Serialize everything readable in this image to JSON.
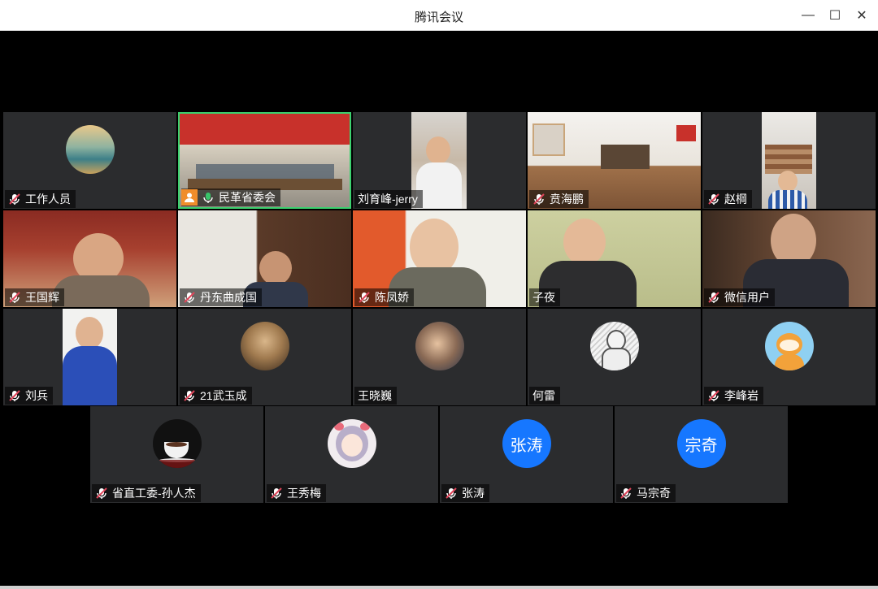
{
  "window": {
    "title": "腾讯会议"
  },
  "controls": {
    "minimize": "—",
    "maximize": "☐",
    "close": "✕"
  },
  "colors": {
    "active_border": "#3bd16f",
    "avatar_blue": "#1677ff",
    "host_badge": "#f08d2b",
    "mic_muted": "#e0455a",
    "mic_on": "#39c46a"
  },
  "participants": [
    {
      "name": "工作人员",
      "mic": "muted",
      "media": "avatar-landscape-painting"
    },
    {
      "name": "民革省委会",
      "mic": "on",
      "host": true,
      "media": "video-meeting-room-banner"
    },
    {
      "name": "刘育峰-jerry",
      "mic": "none",
      "media": "video"
    },
    {
      "name": "贲海鹏",
      "mic": "muted",
      "media": "video-office"
    },
    {
      "name": "赵棡",
      "mic": "muted",
      "media": "video"
    },
    {
      "name": "王国辉",
      "mic": "muted",
      "media": "video"
    },
    {
      "name": "丹东曲成国",
      "mic": "muted",
      "media": "video"
    },
    {
      "name": "陈凤娇",
      "mic": "muted",
      "media": "video"
    },
    {
      "name": "子夜",
      "mic": "none",
      "media": "video"
    },
    {
      "name": "微信用户",
      "mic": "muted",
      "media": "video"
    },
    {
      "name": "刘兵",
      "mic": "muted",
      "media": "video"
    },
    {
      "name": "21武玉成",
      "mic": "muted",
      "media": "avatar-photo"
    },
    {
      "name": "王晓巍",
      "mic": "none",
      "media": "avatar-photo"
    },
    {
      "name": "何雷",
      "mic": "none",
      "media": "avatar-sketch"
    },
    {
      "name": "李峰岩",
      "mic": "muted",
      "media": "avatar-cartoon-tiger"
    },
    {
      "name": "省直工委-孙人杰",
      "mic": "muted",
      "media": "avatar-coffee"
    },
    {
      "name": "王秀梅",
      "mic": "muted",
      "media": "avatar-anime-girl"
    },
    {
      "name": "张涛",
      "mic": "muted",
      "media": "avatar-text",
      "avatar_text": "张涛"
    },
    {
      "name": "马宗奇",
      "mic": "muted",
      "media": "avatar-text",
      "avatar_text": "宗奇"
    }
  ]
}
